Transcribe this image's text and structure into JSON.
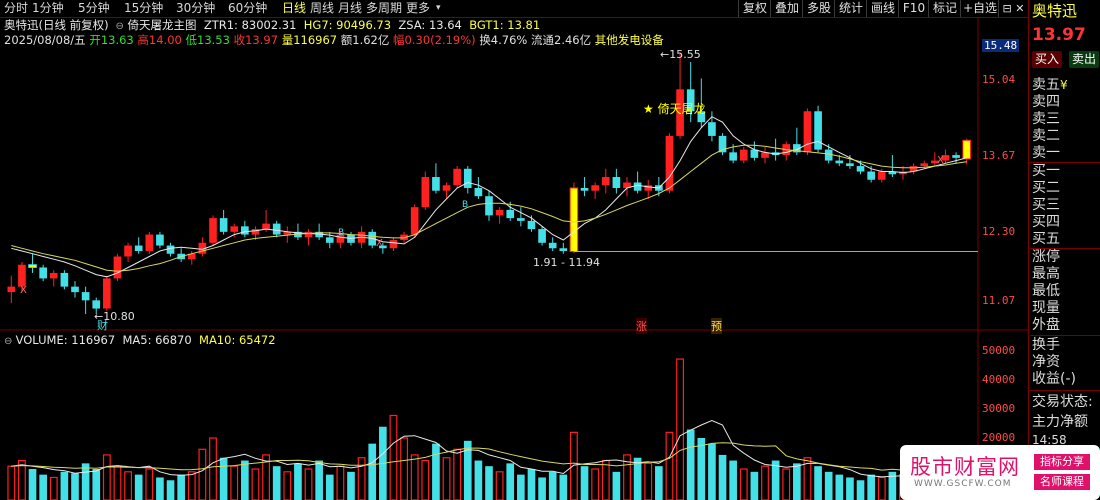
{
  "toolbar": {
    "left_items": [
      "分时",
      "1分钟",
      "5分钟",
      "15分钟",
      "30分钟",
      "60分钟",
      "日线",
      "周线",
      "月线",
      "多周期",
      "更多"
    ],
    "active": "日线",
    "right_items": [
      "复权",
      "叠加",
      "多股",
      "统计",
      "画线",
      "F10",
      "标记",
      "+自选"
    ]
  },
  "stock": {
    "name": "奥特迅",
    "title_line": "奥特迅(日线 前复权)",
    "indicator_name": "倚天屠龙主图",
    "ztr1_label": "ZTR1: 83002.31",
    "hg7_label": "HG7: 90496.73",
    "zsa_label": "ZSA: 13.64",
    "bgt1_label": "BGT1: 13.81"
  },
  "day": {
    "date": "2025/08/08/五",
    "open": "开13.63",
    "high": "高14.00",
    "low": "低13.53",
    "close": "收13.97",
    "volume": "量116967",
    "amount": "额1.62亿",
    "change": "幅0.30(2.19%)",
    "turnover": "换4.76%",
    "float_cap": "流通2.46亿",
    "sector": "其他发电设备"
  },
  "price_axis": [
    "15.48",
    "15.04",
    "13.67",
    "12.30",
    "11.07"
  ],
  "annotations": {
    "high_label": "15.55",
    "low_label": "10.80",
    "signal_name": "倚天屠龙",
    "range_label": "1.91 - 11.94",
    "marker_cai": "财",
    "marker_zhang": "涨",
    "marker_yu": "预",
    "x_mark": "X",
    "b_mark": "B"
  },
  "volume_info": {
    "label": "VOLUME: 116967",
    "ma5": "MA5: 66870",
    "ma10": "MA10: 65472"
  },
  "volume_axis": [
    "50000",
    "40000",
    "30000",
    "20000"
  ],
  "right_panel": {
    "stock_name": "奥特迅",
    "price": "13.97",
    "buy_label": "买入",
    "sell_label": "卖出",
    "rows": [
      "卖五",
      "卖四",
      "卖三",
      "卖二",
      "卖一",
      "买一",
      "买二",
      "买三",
      "买四",
      "买五",
      "涨停",
      "最高",
      "最低",
      "现量",
      "外盘",
      "换手",
      "净资",
      "收益(-)",
      "交易状态:",
      "主力净额",
      "14:58"
    ],
    "sell5_suffix": "¥"
  },
  "watermark": {
    "site": "股市财富网",
    "url": "WWW.GSCFW.COM",
    "tag1": "指标分享",
    "tag2": "名师课程"
  },
  "colors": {
    "up": "#ff2020",
    "down": "#44e0e8",
    "ma_white": "#e8e8e8",
    "ma_yellow": "#d8d860",
    "highlight_yellow": "#ffff00"
  },
  "chart_data": {
    "type": "candlestick",
    "y_range": [
      10.6,
      15.8
    ],
    "candles": [
      [
        11.2,
        11.5,
        11.0,
        11.3
      ],
      [
        11.3,
        11.75,
        11.2,
        11.7
      ],
      [
        11.7,
        11.9,
        11.55,
        11.65
      ],
      [
        11.65,
        11.7,
        11.4,
        11.45
      ],
      [
        11.45,
        11.6,
        11.3,
        11.55
      ],
      [
        11.55,
        11.6,
        11.25,
        11.3
      ],
      [
        11.3,
        11.4,
        11.1,
        11.2
      ],
      [
        11.2,
        11.3,
        10.8,
        11.05
      ],
      [
        11.05,
        11.1,
        10.8,
        10.9
      ],
      [
        10.9,
        11.5,
        10.85,
        11.45
      ],
      [
        11.45,
        11.9,
        11.4,
        11.85
      ],
      [
        11.85,
        12.1,
        11.75,
        12.05
      ],
      [
        12.05,
        12.2,
        11.9,
        11.95
      ],
      [
        11.95,
        12.3,
        11.9,
        12.25
      ],
      [
        12.25,
        12.3,
        12.0,
        12.05
      ],
      [
        12.05,
        12.1,
        11.85,
        11.9
      ],
      [
        11.9,
        12.0,
        11.75,
        11.8
      ],
      [
        11.8,
        11.95,
        11.7,
        11.9
      ],
      [
        11.9,
        12.2,
        11.85,
        12.1
      ],
      [
        12.1,
        12.6,
        12.05,
        12.55
      ],
      [
        12.55,
        12.7,
        12.25,
        12.3
      ],
      [
        12.3,
        12.45,
        12.2,
        12.4
      ],
      [
        12.4,
        12.5,
        12.2,
        12.25
      ],
      [
        12.25,
        12.4,
        12.15,
        12.35
      ],
      [
        12.35,
        12.7,
        12.3,
        12.45
      ],
      [
        12.45,
        12.5,
        12.2,
        12.25
      ],
      [
        12.25,
        12.4,
        12.1,
        12.3
      ],
      [
        12.3,
        12.45,
        12.15,
        12.2
      ],
      [
        12.2,
        12.35,
        12.05,
        12.3
      ],
      [
        12.3,
        12.45,
        12.15,
        12.2
      ],
      [
        12.2,
        12.3,
        12.0,
        12.1
      ],
      [
        12.1,
        12.3,
        12.0,
        12.25
      ],
      [
        12.25,
        12.3,
        12.05,
        12.1
      ],
      [
        12.1,
        12.4,
        12.0,
        12.3
      ],
      [
        12.3,
        12.35,
        12.0,
        12.05
      ],
      [
        12.05,
        12.1,
        11.9,
        12.0
      ],
      [
        12.0,
        12.2,
        11.95,
        12.15
      ],
      [
        12.15,
        12.3,
        12.1,
        12.25
      ],
      [
        12.25,
        12.8,
        12.2,
        12.75
      ],
      [
        12.75,
        13.4,
        12.7,
        13.3
      ],
      [
        13.3,
        13.55,
        13.0,
        13.05
      ],
      [
        13.05,
        13.2,
        12.9,
        13.15
      ],
      [
        13.15,
        13.5,
        13.1,
        13.45
      ],
      [
        13.45,
        13.5,
        13.0,
        13.1
      ],
      [
        13.1,
        13.3,
        12.9,
        12.95
      ],
      [
        12.95,
        13.05,
        12.5,
        12.6
      ],
      [
        12.6,
        12.75,
        12.45,
        12.7
      ],
      [
        12.7,
        12.85,
        12.5,
        12.55
      ],
      [
        12.55,
        12.75,
        12.4,
        12.5
      ],
      [
        12.5,
        12.6,
        12.3,
        12.35
      ],
      [
        12.35,
        12.4,
        12.05,
        12.1
      ],
      [
        12.1,
        12.2,
        11.95,
        12.0
      ],
      [
        12.0,
        12.1,
        11.9,
        11.95
      ],
      [
        11.94,
        13.2,
        11.91,
        13.1
      ],
      [
        13.1,
        13.3,
        12.95,
        13.05
      ],
      [
        13.05,
        13.2,
        12.9,
        13.15
      ],
      [
        13.15,
        13.45,
        13.0,
        13.3
      ],
      [
        13.3,
        13.45,
        13.0,
        13.1
      ],
      [
        13.1,
        13.3,
        12.95,
        13.2
      ],
      [
        13.2,
        13.4,
        13.0,
        13.05
      ],
      [
        13.05,
        13.25,
        12.9,
        13.15
      ],
      [
        13.15,
        13.3,
        12.95,
        13.05
      ],
      [
        13.05,
        14.1,
        13.0,
        14.05
      ],
      [
        14.05,
        15.55,
        14.0,
        14.9
      ],
      [
        14.9,
        15.4,
        14.3,
        14.5
      ],
      [
        14.5,
        15.1,
        14.2,
        14.3
      ],
      [
        14.3,
        14.5,
        13.95,
        14.05
      ],
      [
        14.05,
        14.1,
        13.7,
        13.75
      ],
      [
        13.75,
        13.9,
        13.55,
        13.6
      ],
      [
        13.6,
        13.85,
        13.55,
        13.8
      ],
      [
        13.8,
        13.95,
        13.6,
        13.65
      ],
      [
        13.65,
        13.85,
        13.55,
        13.75
      ],
      [
        13.75,
        14.0,
        13.6,
        13.7
      ],
      [
        13.7,
        13.95,
        13.6,
        13.9
      ],
      [
        13.9,
        14.2,
        13.7,
        13.75
      ],
      [
        13.75,
        14.55,
        13.7,
        14.5
      ],
      [
        14.5,
        14.6,
        13.75,
        13.8
      ],
      [
        13.8,
        13.9,
        13.55,
        13.6
      ],
      [
        13.6,
        13.7,
        13.5,
        13.55
      ],
      [
        13.55,
        13.7,
        13.45,
        13.5
      ],
      [
        13.5,
        13.6,
        13.35,
        13.4
      ],
      [
        13.4,
        13.5,
        13.2,
        13.25
      ],
      [
        13.25,
        13.45,
        13.2,
        13.4
      ],
      [
        13.4,
        13.7,
        13.3,
        13.35
      ],
      [
        13.35,
        13.5,
        13.25,
        13.4
      ],
      [
        13.4,
        13.55,
        13.35,
        13.5
      ],
      [
        13.5,
        13.6,
        13.45,
        13.55
      ],
      [
        13.55,
        13.75,
        13.5,
        13.6
      ],
      [
        13.6,
        13.8,
        13.55,
        13.7
      ],
      [
        13.7,
        13.75,
        13.55,
        13.65
      ],
      [
        13.63,
        14.0,
        13.53,
        13.97
      ]
    ],
    "volumes": [
      12000,
      14000,
      11000,
      9000,
      8000,
      10000,
      9500,
      13000,
      11000,
      16000,
      12000,
      10000,
      9000,
      11000,
      8000,
      7000,
      9000,
      10000,
      18000,
      22000,
      15000,
      12000,
      14000,
      11000,
      16000,
      12000,
      10000,
      13000,
      11000,
      14000,
      9000,
      12000,
      10000,
      15000,
      20000,
      26000,
      30000,
      22000,
      16000,
      14000,
      20000,
      15000,
      18000,
      21000,
      14000,
      12000,
      10000,
      13000,
      9000,
      11000,
      8000,
      10000,
      9000,
      24000,
      12000,
      11000,
      14000,
      10000,
      16000,
      15000,
      13000,
      12000,
      24000,
      50000,
      25000,
      22000,
      20000,
      16000,
      14000,
      11000,
      10000,
      12000,
      14000,
      11000,
      13000,
      15000,
      12000,
      10000,
      9000,
      8000,
      7000,
      9000,
      8000,
      10000,
      9000,
      11000,
      8000,
      9000,
      10000,
      9000,
      11697
    ],
    "ma5": [
      12.0,
      11.95,
      11.9,
      11.85,
      11.8,
      11.75,
      11.68,
      11.6,
      11.52,
      11.48,
      11.55,
      11.65,
      11.75,
      11.85,
      11.95,
      12.0,
      12.02,
      12.0,
      11.98,
      12.05,
      12.15,
      12.25,
      12.3,
      12.32,
      12.35,
      12.33,
      12.3,
      12.28,
      12.27,
      12.26,
      12.24,
      12.2,
      12.18,
      12.2,
      12.18,
      12.12,
      12.1,
      12.08,
      12.2,
      12.45,
      12.7,
      12.9,
      13.1,
      13.2,
      13.15,
      13.05,
      12.9,
      12.75,
      12.65,
      12.55,
      12.4,
      12.25,
      12.15,
      12.3,
      12.45,
      12.55,
      12.7,
      12.9,
      13.1,
      13.15,
      13.12,
      13.1,
      13.3,
      13.6,
      13.95,
      14.2,
      14.4,
      14.3,
      14.05,
      13.9,
      13.8,
      13.75,
      13.72,
      13.75,
      13.8,
      13.9,
      13.95,
      13.85,
      13.75,
      13.65,
      13.55,
      13.45,
      13.4,
      13.4,
      13.38,
      13.4,
      13.45,
      13.5,
      13.55,
      13.6,
      13.65
    ],
    "ma10": [
      12.05,
      12.0,
      11.95,
      11.9,
      11.86,
      11.82,
      11.78,
      11.72,
      11.66,
      11.6,
      11.58,
      11.6,
      11.63,
      11.68,
      11.72,
      11.78,
      11.85,
      11.9,
      11.95,
      12.0,
      12.05,
      12.1,
      12.15,
      12.18,
      12.2,
      12.22,
      12.24,
      12.26,
      12.27,
      12.28,
      12.28,
      12.27,
      12.25,
      12.24,
      12.22,
      12.2,
      12.19,
      12.19,
      12.25,
      12.35,
      12.45,
      12.55,
      12.65,
      12.75,
      12.8,
      12.82,
      12.82,
      12.8,
      12.77,
      12.72,
      12.65,
      12.58,
      12.5,
      12.48,
      12.5,
      12.55,
      12.62,
      12.7,
      12.78,
      12.85,
      12.92,
      13.0,
      13.1,
      13.25,
      13.4,
      13.55,
      13.7,
      13.8,
      13.85,
      13.88,
      13.88,
      13.86,
      13.83,
      13.8,
      13.78,
      13.76,
      13.74,
      13.72,
      13.68,
      13.63,
      13.58,
      13.54,
      13.5,
      13.48,
      13.47,
      13.47,
      13.48,
      13.5,
      13.52,
      13.55,
      13.58
    ],
    "vol_ma5": [
      12000,
      12500,
      12000,
      11500,
      10800,
      10400,
      9500,
      9900,
      10300,
      11900,
      12200,
      11800,
      11500,
      12000,
      10000,
      9000,
      8800,
      9000,
      10400,
      13200,
      14800,
      15400,
      16200,
      14800,
      13800,
      13800,
      12600,
      13000,
      12400,
      13000,
      11800,
      12000,
      11400,
      12000,
      13200,
      16400,
      20200,
      22600,
      22800,
      21600,
      20400,
      17400,
      16600,
      17800,
      17600,
      16000,
      15000,
      14000,
      11600,
      11000,
      10200,
      10200,
      9400,
      12400,
      12800,
      13200,
      14000,
      14200,
      13600,
      13200,
      13600,
      13000,
      15200,
      22800,
      24800,
      26600,
      28200,
      26600,
      19400,
      16600,
      14200,
      12600,
      12200,
      11600,
      12000,
      13000,
      13000,
      12400,
      11800,
      10800,
      9200,
      8600,
      8200,
      8400,
      8600,
      9400,
      9200,
      9400,
      9400,
      9400,
      9540
    ],
    "vol_ma10": [
      12000,
      12200,
      12100,
      11900,
      11600,
      11500,
      11300,
      11400,
      11300,
      11700,
      11700,
      11600,
      11500,
      11500,
      11300,
      11000,
      10700,
      10800,
      11100,
      11800,
      12000,
      12200,
      12700,
      13100,
      13500,
      14000,
      14000,
      14100,
      13900,
      13300,
      12800,
      12700,
      12300,
      12300,
      12500,
      13000,
      13600,
      14000,
      14500,
      15100,
      16200,
      17000,
      17800,
      18400,
      18400,
      18100,
      17100,
      16200,
      15400,
      14600,
      13800,
      13300,
      12800,
      13100,
      12600,
      12600,
      12500,
      12100,
      12500,
      12900,
      13400,
      13600,
      14800,
      17600,
      18800,
      19300,
      20100,
      20300,
      20200,
      19500,
      19200,
      19100,
      19200,
      15700,
      14600,
      13900,
      13100,
      12500,
      12000,
      11700,
      11400,
      11200,
      10600,
      10900,
      10600,
      10700,
      10300,
      10200,
      10300,
      10400,
      10500
    ],
    "volume_range": [
      0,
      55000
    ]
  }
}
